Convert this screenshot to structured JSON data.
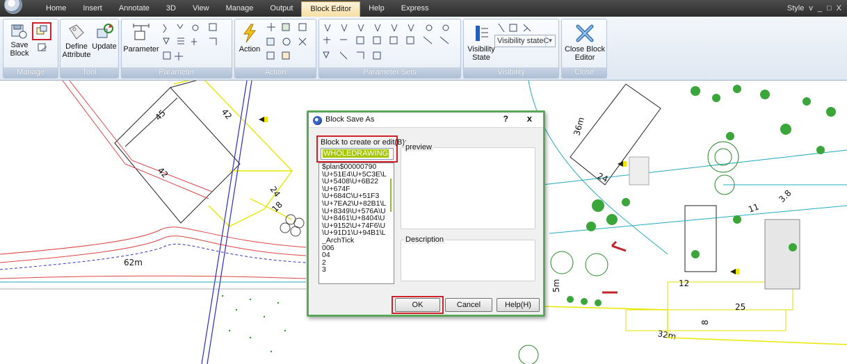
{
  "menu": {
    "tabs": [
      "Home",
      "Insert",
      "Annotate",
      "3D",
      "View",
      "Manage",
      "Output",
      "Block Editor",
      "Help",
      "Express"
    ],
    "active_tab": "Block Editor",
    "right": {
      "style_label": "Style",
      "chevron": "v",
      "minimize": "_",
      "restore": "□",
      "close": "X"
    }
  },
  "ribbon": {
    "save_block": "Save Block",
    "define_attribute_line1": "Define",
    "define_attribute_line2": "Attribute",
    "update": "Update",
    "parameter": "Parameter",
    "action": "Action",
    "visibility_state_line1": "Visibility",
    "visibility_state_line2": "State",
    "visibility_select": "Visibility stateC",
    "close_block_editor_line1": "Close Block",
    "close_block_editor_line2": "Editor",
    "panels": {
      "manage": "Manage",
      "tool": "Tool",
      "parameter": "Parameter",
      "action": "Action",
      "parameter_sets": "Parameter Sets",
      "visibility": "Visibility",
      "close": "Close"
    }
  },
  "drawing_labels": {
    "d45": "45",
    "d42a": "42",
    "d42b": "42",
    "d24a": "24",
    "d18": "18",
    "d62m": "62m",
    "d36m": "36m",
    "d24b": "24",
    "d38": "3.8",
    "d11": "11",
    "d12": "12",
    "d25": "25",
    "d32m": "32m",
    "d5m": "5m",
    "d8": "8"
  },
  "dialog": {
    "title": "Block Save As",
    "help_q": "?",
    "close_x": "x",
    "block_label": "Block to create or edit(B):",
    "block_value": "WHOLEDRAWING",
    "blocks": [
      "$plan$00000790",
      "\\U+51E4\\U+5C3E\\L",
      "\\U+5408\\U+6B22",
      "\\U+674F",
      "\\U+684C\\U+51F3",
      "\\U+7EA2\\U+82B1\\L",
      "\\U+8349\\U+576A\\U",
      "\\U+8461\\U+8404\\U",
      "\\U+9152\\U+74F6\\U",
      "\\U+91D1\\U+94B1\\L",
      "_ArchTick",
      "006",
      "04",
      "2",
      "3"
    ],
    "preview_label": "preview",
    "description_label": "Description",
    "ok": "OK",
    "cancel": "Cancel",
    "help": "Help(H)"
  },
  "colors": {
    "highlight_box": "#d0202a",
    "dialog_border": "#5aa65a",
    "selection": "#a5c600",
    "menubar": "#3a3a3a"
  }
}
